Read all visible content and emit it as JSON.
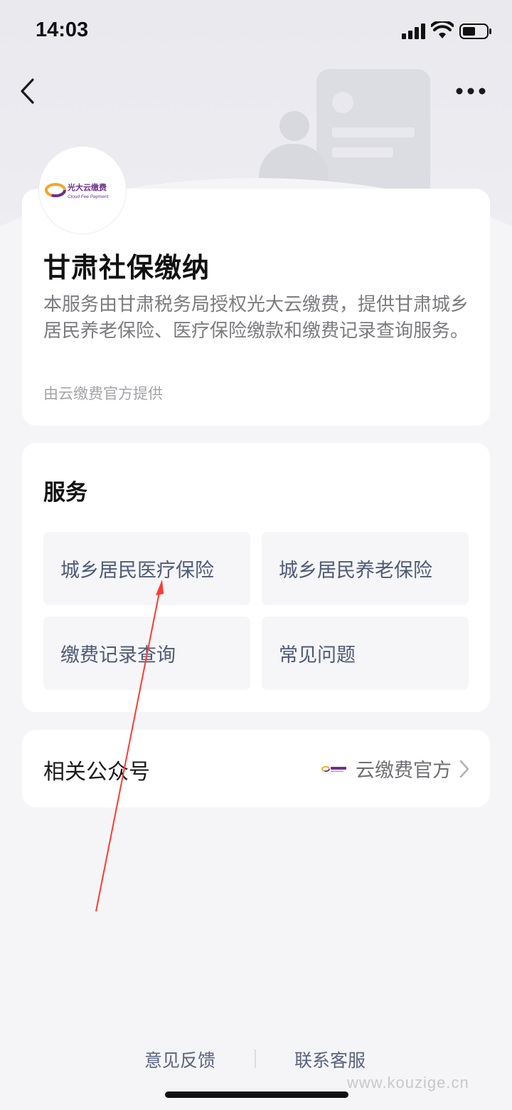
{
  "status_bar": {
    "time": "14:03"
  },
  "service": {
    "logo_text": "光大云缴费",
    "logo_subtext": "Cloud Fee Payment",
    "title": "甘肃社保缴纳",
    "description": "本服务由甘肃税务局授权光大云缴费，提供甘肃城乡居民养老保险、医疗保险缴款和缴费记录查询服务。",
    "provider": "由云缴费官方提供"
  },
  "services_section": {
    "heading": "服务",
    "items": [
      {
        "label": "城乡居民医疗保险"
      },
      {
        "label": "城乡居民养老保险"
      },
      {
        "label": "缴费记录查询"
      },
      {
        "label": "常见问题"
      }
    ]
  },
  "related": {
    "label": "相关公众号",
    "account_name": "云缴费官方"
  },
  "footer": {
    "feedback": "意见反馈",
    "contact": "联系客服"
  },
  "watermark": "www.kouzige.cn",
  "colors": {
    "accent_text": "#4e5a78",
    "annotation_arrow": "#ff3b30",
    "logo_purple": "#6d2f8e",
    "logo_orange": "#f5a623"
  }
}
